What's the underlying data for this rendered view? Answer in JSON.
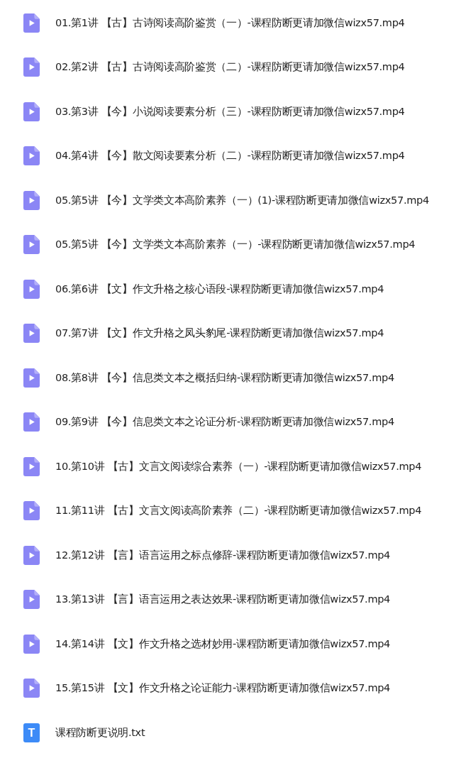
{
  "files": [
    {
      "kind": "video",
      "name": "01.第1讲 【古】古诗阅读高阶鉴赏（一）-课程防断更请加微信wizx57.mp4"
    },
    {
      "kind": "video",
      "name": "02.第2讲 【古】古诗阅读高阶鉴赏（二）-课程防断更请加微信wizx57.mp4"
    },
    {
      "kind": "video",
      "name": "03.第3讲 【今】小说阅读要素分析（三）-课程防断更请加微信wizx57.mp4"
    },
    {
      "kind": "video",
      "name": "04.第4讲 【今】散文阅读要素分析（二）-课程防断更请加微信wizx57.mp4"
    },
    {
      "kind": "video",
      "name": "05.第5讲 【今】文学类文本高阶素养（一）(1)-课程防断更请加微信wizx57.mp4"
    },
    {
      "kind": "video",
      "name": "05.第5讲 【今】文学类文本高阶素养（一）-课程防断更请加微信wizx57.mp4"
    },
    {
      "kind": "video",
      "name": "06.第6讲 【文】作文升格之核心语段-课程防断更请加微信wizx57.mp4"
    },
    {
      "kind": "video",
      "name": "07.第7讲 【文】作文升格之凤头豹尾-课程防断更请加微信wizx57.mp4"
    },
    {
      "kind": "video",
      "name": "08.第8讲 【今】信息类文本之概括归纳-课程防断更请加微信wizx57.mp4"
    },
    {
      "kind": "video",
      "name": "09.第9讲 【今】信息类文本之论证分析-课程防断更请加微信wizx57.mp4"
    },
    {
      "kind": "video",
      "name": "10.第10讲 【古】文言文阅读综合素养（一）-课程防断更请加微信wizx57.mp4"
    },
    {
      "kind": "video",
      "name": "11.第11讲 【古】文言文阅读高阶素养（二）-课程防断更请加微信wizx57.mp4"
    },
    {
      "kind": "video",
      "name": "12.第12讲 【言】语言运用之标点修辞-课程防断更请加微信wizx57.mp4"
    },
    {
      "kind": "video",
      "name": "13.第13讲 【言】语言运用之表达效果-课程防断更请加微信wizx57.mp4"
    },
    {
      "kind": "video",
      "name": "14.第14讲 【文】作文升格之选材妙用-课程防断更请加微信wizx57.mp4"
    },
    {
      "kind": "video",
      "name": "15.第15讲 【文】作文升格之论证能力-课程防断更请加微信wizx57.mp4"
    },
    {
      "kind": "text",
      "icon_text": "T",
      "name": "课程防断更说明.txt"
    }
  ]
}
